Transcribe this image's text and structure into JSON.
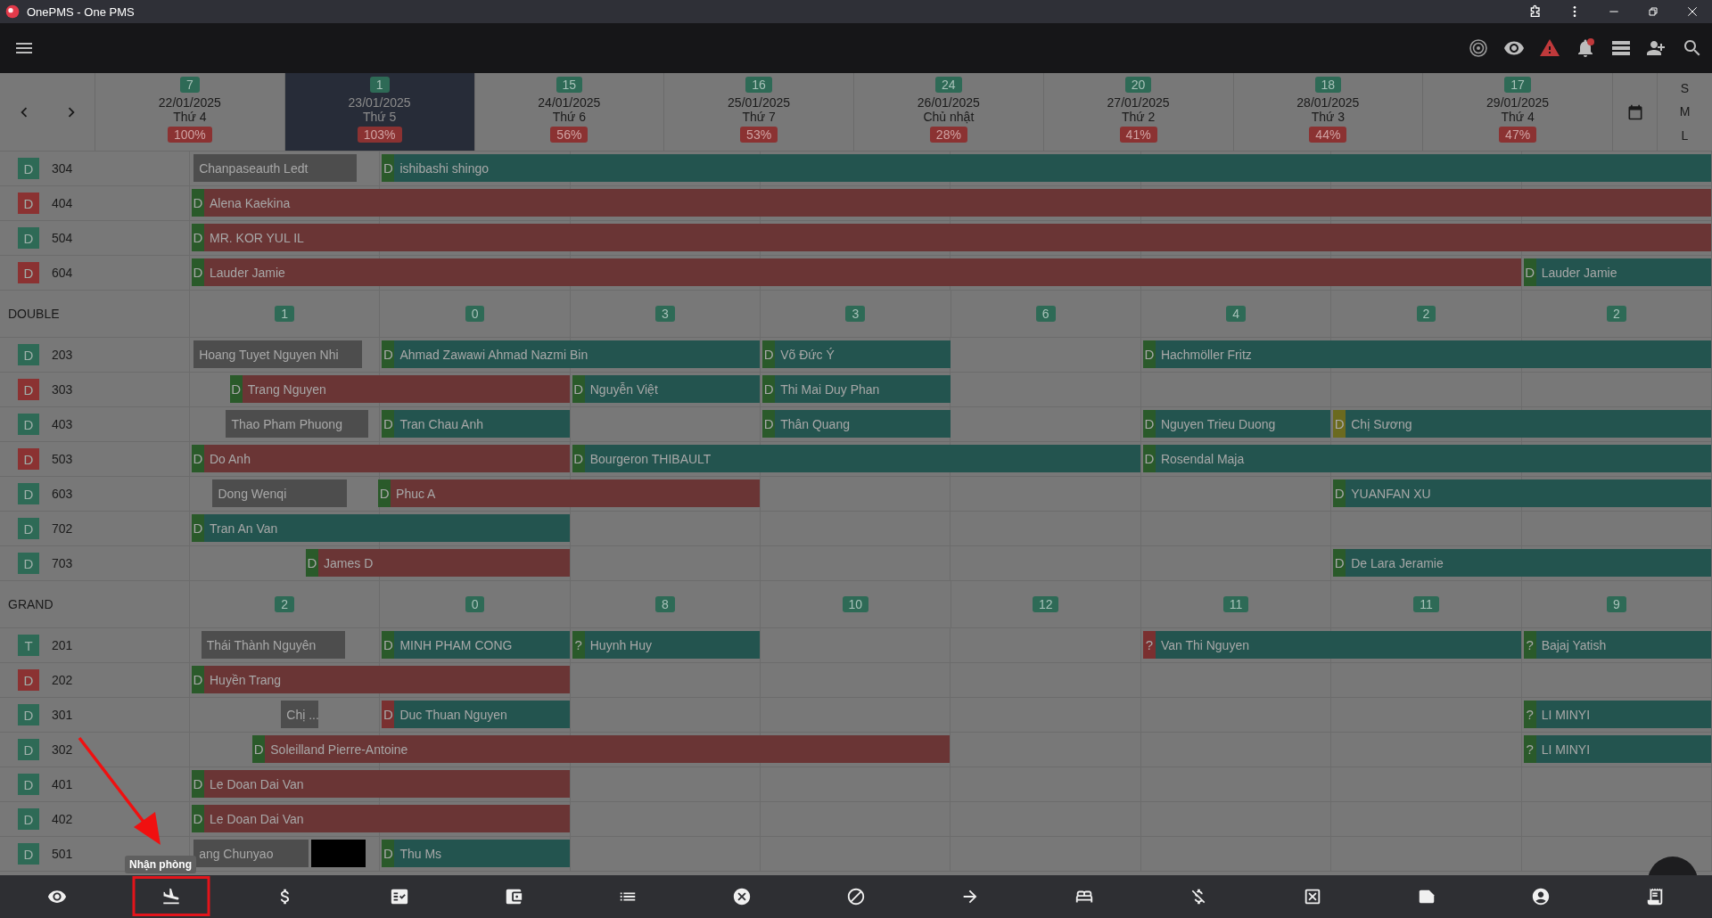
{
  "window": {
    "title": "OnePMS - One PMS"
  },
  "days": [
    {
      "count": "7",
      "date": "22/01/2025",
      "weekday": "Thứ 4",
      "occupancy": "100%",
      "selected": false
    },
    {
      "count": "1",
      "date": "23/01/2025",
      "weekday": "Thứ 5",
      "occupancy": "103%",
      "selected": true
    },
    {
      "count": "15",
      "date": "24/01/2025",
      "weekday": "Thứ 6",
      "occupancy": "56%",
      "selected": false
    },
    {
      "count": "16",
      "date": "25/01/2025",
      "weekday": "Thứ 7",
      "occupancy": "53%",
      "selected": false
    },
    {
      "count": "24",
      "date": "26/01/2025",
      "weekday": "Chủ nhật",
      "occupancy": "28%",
      "selected": false
    },
    {
      "count": "20",
      "date": "27/01/2025",
      "weekday": "Thứ 2",
      "occupancy": "41%",
      "selected": false
    },
    {
      "count": "18",
      "date": "28/01/2025",
      "weekday": "Thứ 3",
      "occupancy": "44%",
      "selected": false
    },
    {
      "count": "17",
      "date": "29/01/2025",
      "weekday": "Thứ 4",
      "occupancy": "47%",
      "selected": false
    }
  ],
  "view_sizes": [
    "S",
    "M",
    "L"
  ],
  "sections": [
    {
      "rooms": [
        {
          "status": "D",
          "color": "#2e6a56",
          "number": "304",
          "bookings": [
            {
              "guest": "Chanpaseauth Ledt",
              "color": "#4d4d4d"
            },
            {
              "tag": {
                "label": "D",
                "color": "#2a5a2a"
              },
              "guest": "ishibashi shingo",
              "color": "#23544f"
            }
          ]
        },
        {
          "status": "D",
          "color": "#8b3232",
          "number": "404",
          "bookings": [
            {
              "tag": {
                "label": "D",
                "color": "#2a5a2a"
              },
              "guest": "Alena Kaekina",
              "color": "#6a3535"
            }
          ]
        },
        {
          "status": "D",
          "color": "#2e6a56",
          "number": "504",
          "bookings": [
            {
              "tag": {
                "label": "D",
                "color": "#2a5a2a"
              },
              "guest": "MR. KOR YUL IL",
              "color": "#6a3535"
            }
          ]
        },
        {
          "status": "D",
          "color": "#8b3232",
          "number": "604",
          "bookings": [
            {
              "tag": {
                "label": "D",
                "color": "#2a5a2a"
              },
              "guest": "Lauder Jamie",
              "color": "#6a3535"
            },
            {
              "tag": {
                "label": "D",
                "color": "#2a5a2a"
              },
              "guest": "Lauder Jamie",
              "color": "#23544f"
            }
          ]
        }
      ]
    },
    {
      "name": "DOUBLE",
      "counts": [
        "1",
        "0",
        "3",
        "3",
        "6",
        "4",
        "2",
        "2"
      ],
      "rooms": [
        {
          "status": "D",
          "color": "#2e6a56",
          "number": "203",
          "bookings": [
            {
              "guest": "Hoang Tuyet Nguyen Nhi",
              "color": "#4d4d4d"
            },
            {
              "tag": {
                "label": "D",
                "color": "#2a5a2a"
              },
              "guest": "Ahmad Zawawi Ahmad Nazmi Bin",
              "color": "#23544f"
            },
            {
              "tag": {
                "label": "D",
                "color": "#2a5a2a"
              },
              "guest": "Võ Đức Ý",
              "color": "#23544f"
            },
            {
              "tag": {
                "label": "D",
                "color": "#2a5a2a"
              },
              "guest": "Hachmöller Fritz",
              "color": "#23544f"
            }
          ]
        },
        {
          "status": "D",
          "color": "#8b3232",
          "number": "303",
          "bookings": [
            {
              "tag": {
                "label": "D",
                "color": "#2a5a2a"
              },
              "guest": "Trang Nguyen",
              "color": "#6a3535"
            },
            {
              "tag": {
                "label": "D",
                "color": "#2a5a2a"
              },
              "guest": "Nguyễn Việt",
              "color": "#23544f"
            },
            {
              "tag": {
                "label": "D",
                "color": "#2a5a2a"
              },
              "guest": "Thi Mai Duy Phan",
              "color": "#23544f"
            }
          ]
        },
        {
          "status": "D",
          "color": "#2e6a56",
          "number": "403",
          "bookings": [
            {
              "guest": "Thao Pham Phuong",
              "color": "#4d4d4d"
            },
            {
              "tag": {
                "label": "D",
                "color": "#2a5a2a"
              },
              "guest": "Tran Chau Anh",
              "color": "#23544f"
            },
            {
              "tag": {
                "label": "D",
                "color": "#2a5a2a"
              },
              "guest": "Thân Quang",
              "color": "#23544f"
            },
            {
              "tag": {
                "label": "D",
                "color": "#2a5a2a"
              },
              "guest": "Nguyen Trieu Duong",
              "color": "#23544f"
            },
            {
              "tag": {
                "label": "D",
                "color": "#6b6a1f"
              },
              "guest": "Chị Sương",
              "color": "#23544f"
            }
          ]
        },
        {
          "status": "D",
          "color": "#8b3232",
          "number": "503",
          "bookings": [
            {
              "tag": {
                "label": "D",
                "color": "#2a5a2a"
              },
              "guest": "Do Anh",
              "color": "#6a3535"
            },
            {
              "tag": {
                "label": "D",
                "color": "#2a5a2a"
              },
              "guest": "Bourgeron THIBAULT",
              "color": "#23544f"
            },
            {
              "tag": {
                "label": "D",
                "color": "#2a5a2a"
              },
              "guest": "Rosendal Maja",
              "color": "#23544f"
            }
          ]
        },
        {
          "status": "D",
          "color": "#2e6a56",
          "number": "603",
          "bookings": [
            {
              "guest": "Dong Wenqi",
              "color": "#4d4d4d"
            },
            {
              "tag": {
                "label": "D",
                "color": "#2a5a2a"
              },
              "guest": "Phuc A",
              "color": "#6a3535"
            },
            {
              "tag": {
                "label": "D",
                "color": "#2a5a2a"
              },
              "guest": "YUANFAN XU",
              "color": "#23544f"
            }
          ]
        },
        {
          "status": "D",
          "color": "#2e6a56",
          "number": "702",
          "bookings": [
            {
              "tag": {
                "label": "D",
                "color": "#2a5a2a"
              },
              "guest": "Tran An Van",
              "color": "#23544f"
            }
          ]
        },
        {
          "status": "D",
          "color": "#2e6a56",
          "number": "703",
          "bookings": [
            {
              "tag": {
                "label": "D",
                "color": "#2a5a2a"
              },
              "guest": "James D",
              "color": "#6a3535"
            },
            {
              "tag": {
                "label": "D",
                "color": "#2a5a2a"
              },
              "guest": "De Lara Jeramie",
              "color": "#23544f"
            }
          ]
        }
      ]
    },
    {
      "name": "GRAND",
      "counts": [
        "2",
        "0",
        "8",
        "10",
        "12",
        "11",
        "11",
        "9"
      ],
      "rooms": [
        {
          "status": "T",
          "color": "#2e6a56",
          "number": "201",
          "bookings": [
            {
              "guest": "Thái Thành Nguyên",
              "color": "#4d4d4d"
            },
            {
              "tag": {
                "label": "D",
                "color": "#2a5a2a"
              },
              "guest": "MINH PHAM CONG",
              "color": "#23544f"
            },
            {
              "tag": {
                "label": "?",
                "color": "#2a5a2a"
              },
              "guest": "Huynh Huy",
              "color": "#23544f"
            },
            {
              "tag": {
                "label": "?",
                "color": "#7a3030"
              },
              "guest": "Van Thi Nguyen",
              "color": "#23544f"
            },
            {
              "tag": {
                "label": "?",
                "color": "#2a5a2a"
              },
              "guest": "Bajaj Yatish",
              "color": "#23544f"
            }
          ]
        },
        {
          "status": "D",
          "color": "#8b3232",
          "number": "202",
          "bookings": [
            {
              "tag": {
                "label": "D",
                "color": "#2a5a2a"
              },
              "guest": "Huyền Trang",
              "color": "#6a3535"
            }
          ]
        },
        {
          "status": "D",
          "color": "#2e6a56",
          "number": "301",
          "bookings": [
            {
              "guest": "Chị ...",
              "color": "#4d4d4d"
            },
            {
              "tag": {
                "label": "D",
                "color": "#7a3030"
              },
              "guest": "Duc Thuan Nguyen",
              "color": "#23544f"
            },
            {
              "tag": {
                "label": "?",
                "color": "#2a5a2a"
              },
              "guest": "LI MINYI",
              "color": "#23544f"
            }
          ]
        },
        {
          "status": "D",
          "color": "#2e6a56",
          "number": "302",
          "bookings": [
            {
              "tag": {
                "label": "D",
                "color": "#2a5a2a"
              },
              "guest": "Soleilland Pierre-Antoine",
              "color": "#6a3535"
            },
            {
              "tag": {
                "label": "?",
                "color": "#2a5a2a"
              },
              "guest": "LI MINYI",
              "color": "#23544f"
            }
          ]
        },
        {
          "status": "D",
          "color": "#2e6a56",
          "number": "401",
          "bookings": [
            {
              "tag": {
                "label": "D",
                "color": "#2a5a2a"
              },
              "guest": "Le Doan Dai Van",
              "color": "#6a3535"
            }
          ]
        },
        {
          "status": "D",
          "color": "#2e6a56",
          "number": "402",
          "bookings": [
            {
              "tag": {
                "label": "D",
                "color": "#2a5a2a"
              },
              "guest": "Le Doan Dai Van",
              "color": "#6a3535"
            }
          ]
        },
        {
          "status": "D",
          "color": "#2e6a56",
          "number": "501",
          "bookings": [
            {
              "guest": "ang Chunyao",
              "color": "#4d4d4d"
            },
            {
              "color": "#000000"
            },
            {
              "tag": {
                "label": "D",
                "color": "#2a5a2a"
              },
              "guest": "Thu Ms",
              "color": "#23544f"
            }
          ]
        }
      ]
    }
  ],
  "toolbar": [
    {
      "highlighted": false
    },
    {
      "highlighted": true,
      "tooltip": "Nhận phòng"
    },
    {
      "highlighted": false
    },
    {
      "highlighted": false
    },
    {
      "highlighted": false
    },
    {
      "highlighted": false
    },
    {
      "highlighted": false
    },
    {
      "highlighted": false
    },
    {
      "highlighted": false
    },
    {
      "highlighted": false
    },
    {
      "highlighted": false
    },
    {
      "highlighted": false
    },
    {
      "highlighted": false
    },
    {
      "highlighted": false
    },
    {
      "highlighted": false
    }
  ]
}
